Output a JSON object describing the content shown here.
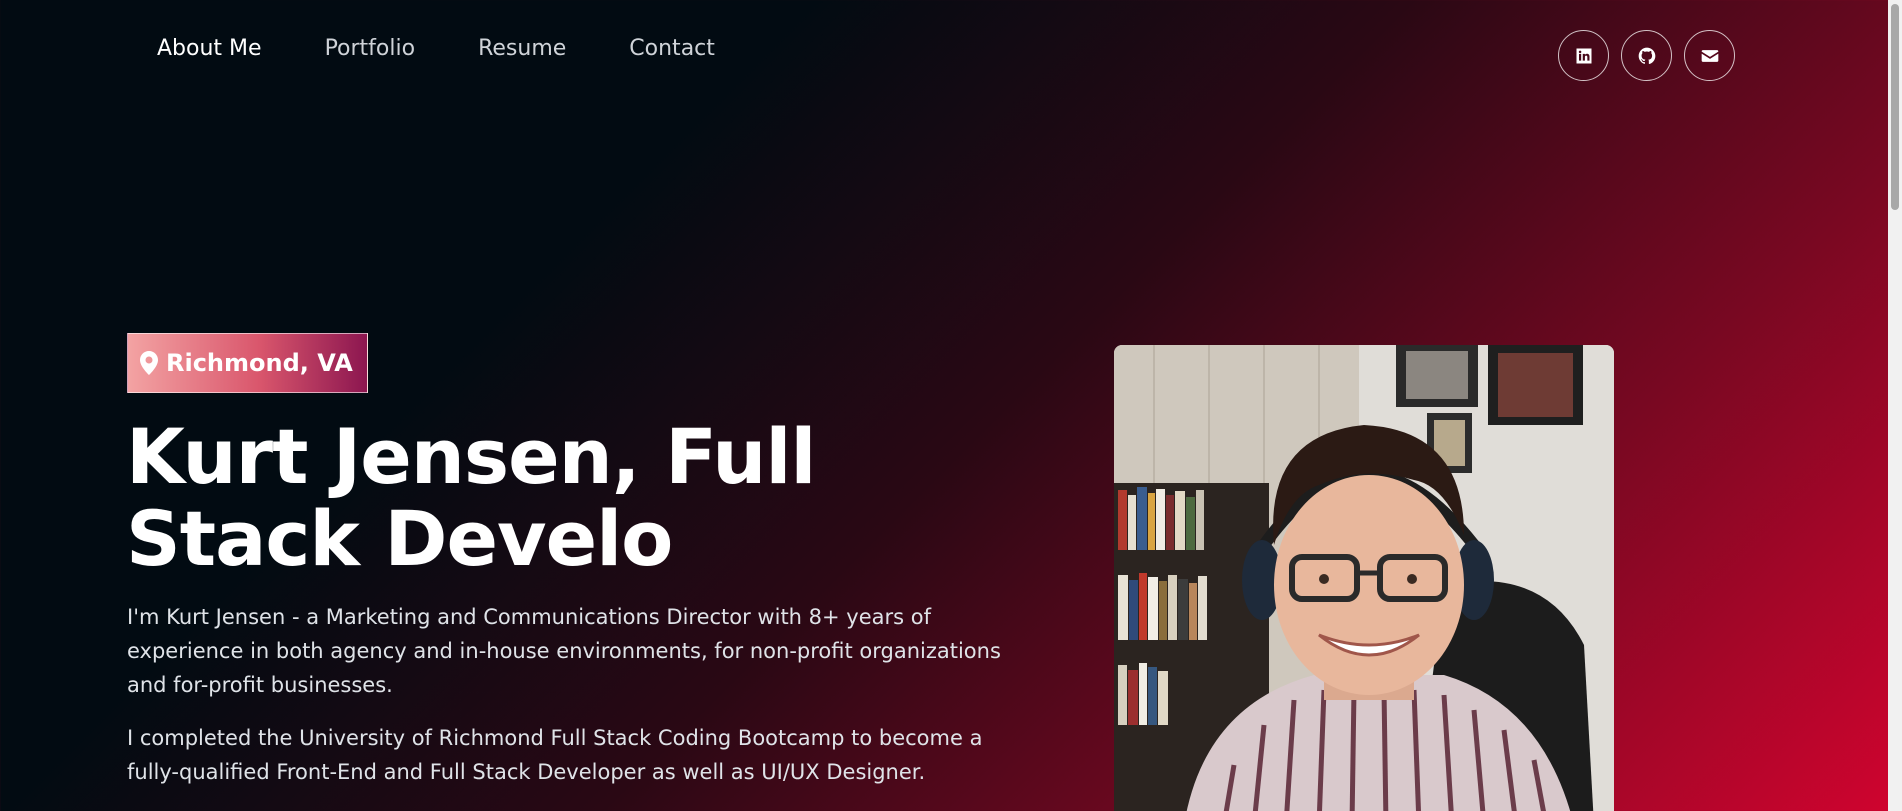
{
  "nav": {
    "links": [
      "About Me",
      "Portfolio",
      "Resume",
      "Contact"
    ],
    "active": "About Me"
  },
  "socials": {
    "icons": [
      "linkedin-icon",
      "github-icon",
      "envelope-icon"
    ]
  },
  "hero": {
    "location": "Richmond, VA",
    "title": "Kurt Jensen, Full Stack Develo",
    "bio_1": "I'm Kurt Jensen - a Marketing and Communications Director with 8+ years of experience in both agency and in-house environments, for non-profit organizations and for-profit businesses.",
    "bio_2": "I completed the University of Richmond Full Stack Coding Bootcamp to become a fully-qualified Front-End and Full Stack Developer as well as UI/UX Designer."
  },
  "colors": {
    "background_dark": "#020b12",
    "background_accent": "#d1042f",
    "badge_start": "#f3a3a3",
    "badge_end": "#8c1650"
  }
}
